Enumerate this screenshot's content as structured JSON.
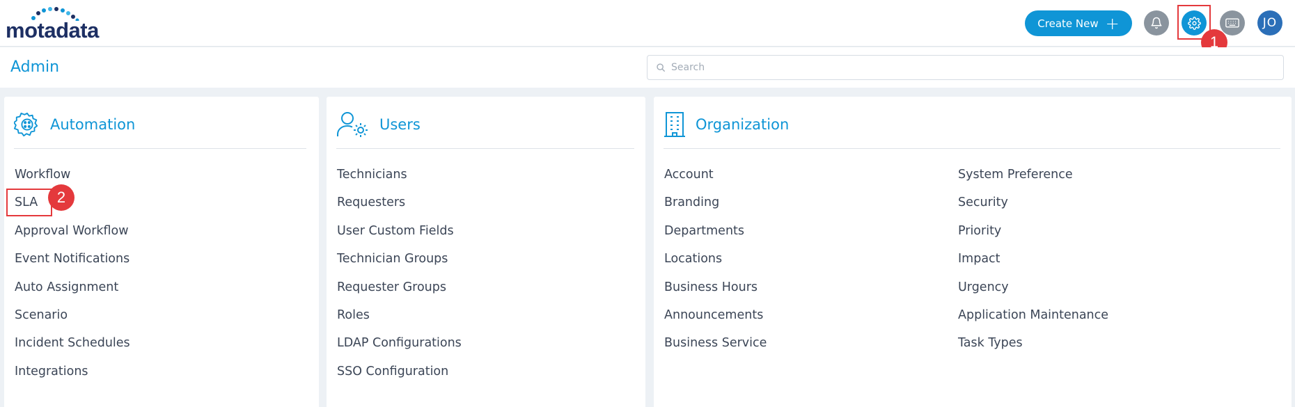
{
  "header": {
    "logo_text": "motadata",
    "create_button": "Create New",
    "avatar_initials": "JO",
    "icons": [
      "bell-icon",
      "gear-icon",
      "keyboard-icon",
      "plus-icon"
    ]
  },
  "page": {
    "title": "Admin",
    "search_placeholder": "Search"
  },
  "annotations": {
    "step1": "1",
    "step2": "2",
    "color": "#e4393c"
  },
  "panels": {
    "automation": {
      "title": "Automation",
      "icon": "automation-gear-icon",
      "items": [
        "Workflow",
        "SLA",
        "Approval Workflow",
        "Event Notifications",
        "Auto Assignment",
        "Scenario",
        "Incident Schedules",
        "Integrations"
      ]
    },
    "users": {
      "title": "Users",
      "icon": "user-settings-icon",
      "items": [
        "Technicians",
        "Requesters",
        "User Custom Fields",
        "Technician Groups",
        "Requester Groups",
        "Roles",
        "LDAP Configurations",
        "SSO Configuration"
      ]
    },
    "organization": {
      "title": "Organization",
      "icon": "building-icon",
      "col1": [
        "Account",
        "Branding",
        "Departments",
        "Locations",
        "Business Hours",
        "Announcements",
        "Business Service"
      ],
      "col2": [
        "System Preference",
        "Security",
        "Priority",
        "Impact",
        "Urgency",
        "Application Maintenance",
        "Task Types"
      ]
    }
  },
  "colors": {
    "accent": "#0f95d6",
    "text": "#3b4556",
    "background": "#edf1f5"
  }
}
